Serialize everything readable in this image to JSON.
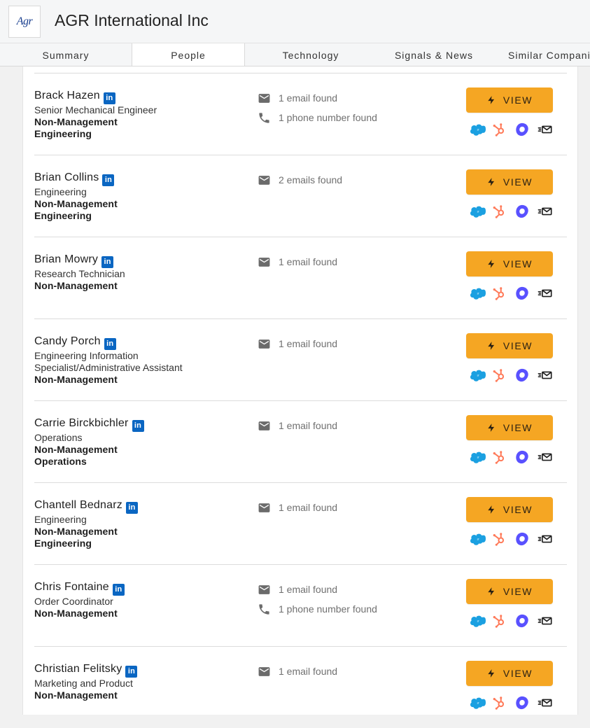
{
  "company": {
    "logo_text": "Agr",
    "name": "AGR International Inc"
  },
  "tabs": [
    {
      "label": "Summary",
      "active": false
    },
    {
      "label": "People",
      "active": true
    },
    {
      "label": "Technology",
      "active": false
    },
    {
      "label": "Signals & News",
      "active": false
    },
    {
      "label": "Similar Companies",
      "active": false
    }
  ],
  "view_label": "VIEW",
  "linkedin_label": "in",
  "icons": {
    "email": "email-icon",
    "phone": "phone-icon",
    "linkedin": "linkedin-icon",
    "lightning": "lightning-icon",
    "salesforce": "salesforce-icon",
    "hubspot": "hubspot-icon",
    "outreach": "outreach-icon",
    "send_email": "send-email-icon"
  },
  "colors": {
    "accent": "#f5a623",
    "linkedin": "#0a66c2",
    "salesforce": "#1ba0e1",
    "hubspot": "#ff7a59",
    "outreach": "#5951ff"
  },
  "people": [
    {
      "name": "Brack Hazen",
      "title": "Senior Mechanical Engineer",
      "details": [
        "Non-Management",
        "Engineering"
      ],
      "contacts": [
        {
          "type": "email",
          "text": "1 email found"
        },
        {
          "type": "phone",
          "text": "1 phone number found"
        }
      ]
    },
    {
      "name": "Brian Collins",
      "title": "Engineering",
      "details": [
        "Non-Management",
        "Engineering"
      ],
      "contacts": [
        {
          "type": "email",
          "text": "2 emails found"
        }
      ]
    },
    {
      "name": "Brian Mowry",
      "title": "Research Technician",
      "details": [
        "Non-Management"
      ],
      "contacts": [
        {
          "type": "email",
          "text": "1 email found"
        }
      ]
    },
    {
      "name": "Candy Porch",
      "title": "Engineering Information Specialist/Administrative Assistant",
      "title_lines": [
        "Engineering Information",
        "Specialist/Administrative Assistant"
      ],
      "details": [
        "Non-Management"
      ],
      "contacts": [
        {
          "type": "email",
          "text": "1 email found"
        }
      ]
    },
    {
      "name": "Carrie Birckbichler",
      "title": "Operations",
      "details": [
        "Non-Management",
        "Operations"
      ],
      "contacts": [
        {
          "type": "email",
          "text": "1 email found"
        }
      ]
    },
    {
      "name": "Chantell Bednarz",
      "title": "Engineering",
      "details": [
        "Non-Management",
        "Engineering"
      ],
      "contacts": [
        {
          "type": "email",
          "text": "1 email found"
        }
      ]
    },
    {
      "name": "Chris Fontaine",
      "title": "Order Coordinator",
      "details": [
        "Non-Management"
      ],
      "contacts": [
        {
          "type": "email",
          "text": "1 email found"
        },
        {
          "type": "phone",
          "text": "1 phone number found"
        }
      ]
    },
    {
      "name": "Christian Felitsky",
      "title": "Marketing and Product",
      "details": [
        "Non-Management"
      ],
      "contacts": [
        {
          "type": "email",
          "text": "1 email found"
        }
      ]
    }
  ]
}
